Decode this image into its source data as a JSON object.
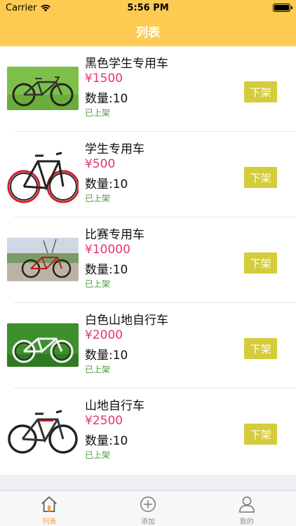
{
  "status": {
    "carrier": "Carrier",
    "time": "5:56 PM"
  },
  "nav": {
    "title": "列表"
  },
  "colors": {
    "accent": "#fdcb52",
    "price": "#e8336d",
    "button": "#d4cc3b",
    "state": "#4a9a35",
    "tab_active": "#f4a43a"
  },
  "items": [
    {
      "name": "黑色学生专用车",
      "price": "¥1500",
      "qty": "数量:10",
      "state": "已上架",
      "button": "下架"
    },
    {
      "name": "学生专用车",
      "price": "¥500",
      "qty": "数量:10",
      "state": "已上架",
      "button": "下架"
    },
    {
      "name": "比赛专用车",
      "price": "¥10000",
      "qty": "数量:10",
      "state": "已上架",
      "button": "下架"
    },
    {
      "name": "白色山地自行车",
      "price": "¥2000",
      "qty": "数量:10",
      "state": "已上架",
      "button": "下架"
    },
    {
      "name": "山地自行车",
      "price": "¥2500",
      "qty": "数量:10",
      "state": "已上架",
      "button": "下架"
    }
  ],
  "tabs": [
    {
      "label": "列表",
      "icon": "home-icon",
      "active": true
    },
    {
      "label": "添加",
      "icon": "add-circle-icon",
      "active": false
    },
    {
      "label": "我的",
      "icon": "person-icon",
      "active": false
    }
  ]
}
